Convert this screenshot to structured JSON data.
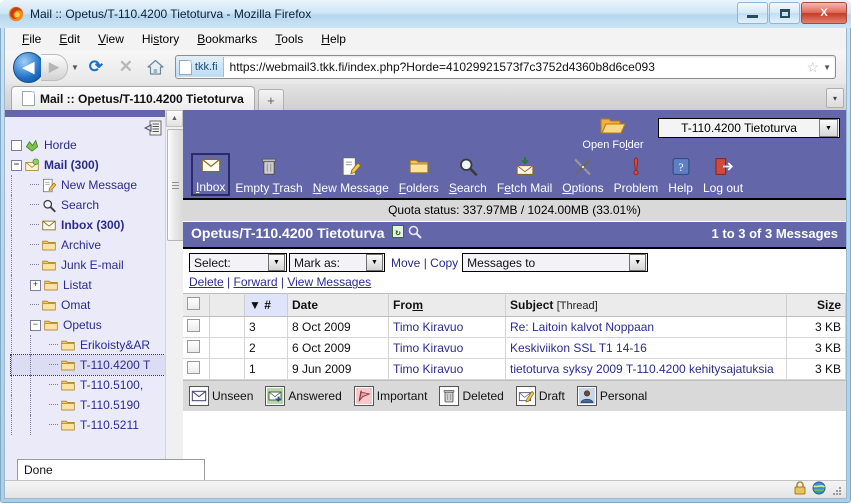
{
  "window": {
    "title": "Mail :: Opetus/T-110.4200 Tietoturva - Mozilla Firefox",
    "minimize_label": "Minimize",
    "maximize_label": "Maximize",
    "close_label": "X"
  },
  "menubar": [
    {
      "label": "File",
      "accel": "F"
    },
    {
      "label": "Edit",
      "accel": "E"
    },
    {
      "label": "View",
      "accel": "V"
    },
    {
      "label": "History",
      "accel": "s"
    },
    {
      "label": "Bookmarks",
      "accel": "B"
    },
    {
      "label": "Tools",
      "accel": "T"
    },
    {
      "label": "Help",
      "accel": "H"
    }
  ],
  "navbar": {
    "back_glyph": "◀",
    "forward_glyph": "▶",
    "reload_glyph": "⟳",
    "stop_glyph": "✕",
    "home_label": "Home",
    "identity_label": "tkk.fi",
    "url": "https://webmail3.tkk.fi/index.php?Horde=41029921573f7c3752d4360b8d6ce093",
    "bookmark_glyph": "☆"
  },
  "tabs": {
    "active": "Mail :: Opetus/T-110.4200 Tietoturva",
    "new_tab_glyph": "+",
    "list_all_glyph": "▾"
  },
  "sidebar": {
    "tree": [
      {
        "label": "Horde",
        "icon": "horde-icon",
        "toggle": "□",
        "count": "",
        "bold": false,
        "depth": 0
      },
      {
        "label": "Mail",
        "icon": "mail-icon",
        "toggle": "−",
        "count": "(300)",
        "bold": true,
        "depth": 0
      },
      {
        "label": "New Message",
        "icon": "compose-icon",
        "toggle": "",
        "count": "",
        "bold": false,
        "depth": 1
      },
      {
        "label": "Search",
        "icon": "search-icon",
        "toggle": "",
        "count": "",
        "bold": false,
        "depth": 1
      },
      {
        "label": "Inbox",
        "icon": "envelope-icon",
        "toggle": "",
        "count": "(300)",
        "bold": true,
        "depth": 1
      },
      {
        "label": "Archive",
        "icon": "folder-icon",
        "toggle": "",
        "count": "",
        "bold": false,
        "depth": 1
      },
      {
        "label": "Junk E-mail",
        "icon": "folder-icon",
        "toggle": "",
        "count": "",
        "bold": false,
        "depth": 1
      },
      {
        "label": "Listat",
        "icon": "folder-icon",
        "toggle": "+",
        "count": "",
        "bold": false,
        "depth": 1
      },
      {
        "label": "Omat",
        "icon": "folder-icon",
        "toggle": "",
        "count": "",
        "bold": false,
        "depth": 1
      },
      {
        "label": "Opetus",
        "icon": "folder-icon",
        "toggle": "−",
        "count": "",
        "bold": false,
        "depth": 1
      },
      {
        "label": "Erikoisty&AR",
        "icon": "folder-icon",
        "toggle": "",
        "count": "",
        "bold": false,
        "depth": 2
      },
      {
        "label": "T-110.4200 T",
        "icon": "folder-icon",
        "toggle": "",
        "count": "",
        "bold": false,
        "depth": 2,
        "selected": true
      },
      {
        "label": "T-110.5100,",
        "icon": "folder-icon",
        "toggle": "",
        "count": "",
        "bold": false,
        "depth": 2
      },
      {
        "label": "T-110.5190",
        "icon": "folder-icon",
        "toggle": "",
        "count": "",
        "bold": false,
        "depth": 2
      },
      {
        "label": "T-110.5211",
        "icon": "folder-icon",
        "toggle": "",
        "count": "",
        "bold": false,
        "depth": 2
      }
    ]
  },
  "mail": {
    "open_folder_label": "Open Folder",
    "folder_select_value": "T-110.4200 Tietoturva",
    "toolbar": [
      {
        "label": "Inbox",
        "accel": "I",
        "icon": "envelope-icon",
        "active": true
      },
      {
        "label": "Empty Trash",
        "accel": "T",
        "icon": "trash-icon",
        "active": false
      },
      {
        "label": "New Message",
        "accel": "N",
        "icon": "compose-icon",
        "active": false
      },
      {
        "label": "Folders",
        "accel": "F",
        "icon": "folder-icon",
        "active": false
      },
      {
        "label": "Search",
        "accel": "S",
        "icon": "magnifier-icon",
        "active": false
      },
      {
        "label": "Fetch Mail",
        "accel": "e",
        "icon": "fetch-icon",
        "active": false
      },
      {
        "label": "Options",
        "accel": "O",
        "icon": "tools-icon",
        "active": false
      },
      {
        "label": "Problem",
        "accel": "",
        "icon": "exclamation-icon",
        "active": false
      },
      {
        "label": "Help",
        "accel": "",
        "icon": "help-icon",
        "active": false
      },
      {
        "label": "Log out",
        "accel": "",
        "icon": "logout-icon",
        "active": false
      }
    ],
    "quota": "Quota status: 337.97MB / 1024.00MB (33.01%)",
    "folder_title": "Opetus/T-110.4200 Tietoturva",
    "message_count": "1 to 3 of 3 Messages",
    "actions": {
      "select_value": "Select:",
      "mark_as_value": "Mark as:",
      "move_label": "Move",
      "copy_label": "Copy",
      "separator": "|",
      "messages_to_value": "Messages to",
      "links": [
        "Delete",
        "Forward",
        "View Messages"
      ]
    },
    "columns": [
      "",
      "",
      "#",
      "Date",
      "From",
      "Subject [Thread]",
      "Size"
    ],
    "column_sort_glyph": "▼",
    "subject_header": "Subject",
    "subject_thread": "[Thread]",
    "rows": [
      {
        "num": "3",
        "date": "8 Oct 2009",
        "from": "Timo Kiravuo",
        "subject": "Re: Laitoin kalvot Noppaan",
        "size": "3 KB"
      },
      {
        "num": "2",
        "date": "6 Oct 2009",
        "from": "Timo Kiravuo",
        "subject": "Keskiviikon SSL T1 14-16",
        "size": "3 KB"
      },
      {
        "num": "1",
        "date": "9 Jun 2009",
        "from": "Timo Kiravuo",
        "subject": "tietoturva syksy 2009 T-110.4200 kehitysajatuksia",
        "size": "3 KB"
      }
    ],
    "legend": [
      {
        "label": "Unseen",
        "icon": "unseen-envelope-icon"
      },
      {
        "label": "Answered",
        "icon": "answered-envelope-icon"
      },
      {
        "label": "Important",
        "icon": "important-flag-icon"
      },
      {
        "label": "Deleted",
        "icon": "trash-icon"
      },
      {
        "label": "Draft",
        "icon": "draft-icon"
      },
      {
        "label": "Personal",
        "icon": "person-icon"
      }
    ]
  },
  "statusbar": {
    "text": "Done",
    "lock_icon": "lock-icon",
    "globe_icon": "globe-icon"
  },
  "colors": {
    "horde_purple": "#6366a8",
    "link_blue": "#2b2b8f",
    "sorted_col": "#dfe4fb",
    "quota_gray": "#d9d9d9"
  }
}
